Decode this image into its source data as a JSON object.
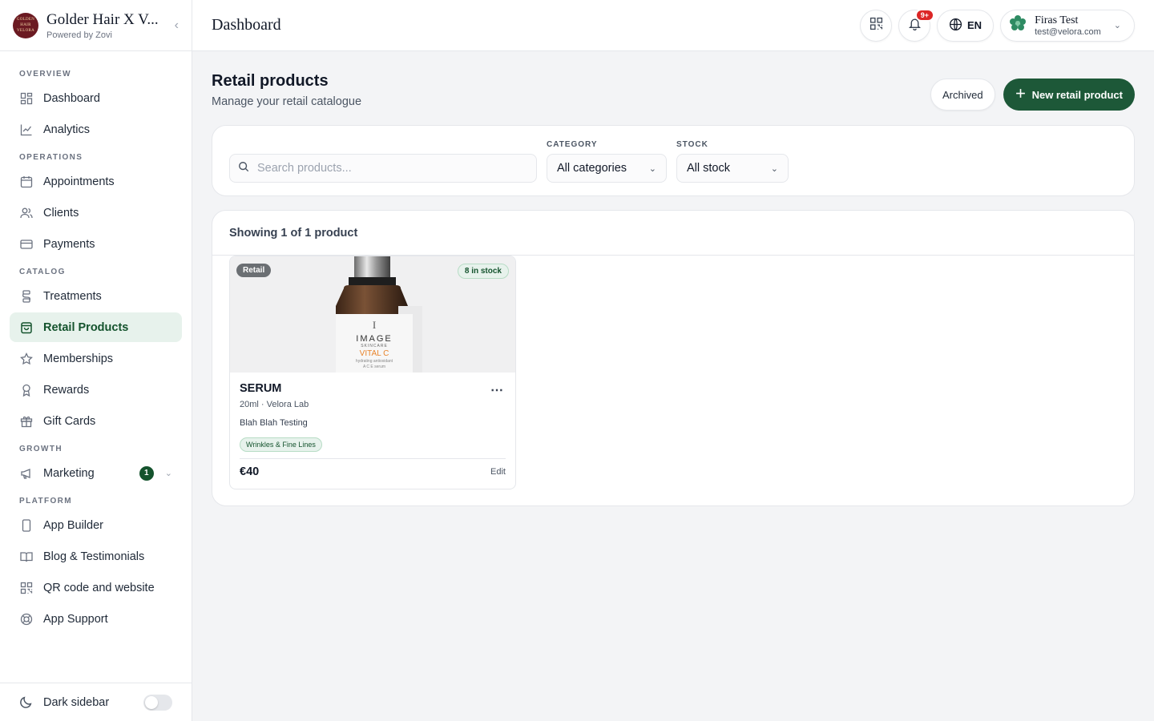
{
  "brand": {
    "name": "Golder Hair X V...",
    "subtitle": "Powered by Zovi",
    "logo_text": "GOLDEN HAIR VELORA"
  },
  "sidebar": {
    "sections": [
      {
        "title": "OVERVIEW",
        "items": [
          {
            "label": "Dashboard",
            "icon": "dashboard-icon"
          },
          {
            "label": "Analytics",
            "icon": "analytics-icon"
          }
        ]
      },
      {
        "title": "OPERATIONS",
        "items": [
          {
            "label": "Appointments",
            "icon": "calendar-icon"
          },
          {
            "label": "Clients",
            "icon": "users-icon"
          },
          {
            "label": "Payments",
            "icon": "credit-card-icon"
          }
        ]
      },
      {
        "title": "CATALOG",
        "items": [
          {
            "label": "Treatments",
            "icon": "treatments-icon"
          },
          {
            "label": "Retail Products",
            "icon": "shopping-bag-icon",
            "active": true
          },
          {
            "label": "Memberships",
            "icon": "star-icon"
          },
          {
            "label": "Rewards",
            "icon": "award-icon"
          },
          {
            "label": "Gift Cards",
            "icon": "gift-icon"
          }
        ]
      },
      {
        "title": "GROWTH",
        "items": [
          {
            "label": "Marketing",
            "icon": "megaphone-icon",
            "badge": "1"
          }
        ]
      },
      {
        "title": "PLATFORM",
        "items": [
          {
            "label": "App Builder",
            "icon": "phone-icon"
          },
          {
            "label": "Blog & Testimonials",
            "icon": "book-icon"
          },
          {
            "label": "QR code and website",
            "icon": "qr-code-icon"
          },
          {
            "label": "App Support",
            "icon": "lifebuoy-icon"
          }
        ]
      }
    ],
    "footer": {
      "label": "Dark sidebar",
      "toggle_on": false
    }
  },
  "topbar": {
    "title": "Dashboard",
    "notifications_badge": "9+",
    "language": "EN",
    "user": {
      "name": "Firas Test",
      "email": "test@velora.com"
    }
  },
  "page": {
    "title": "Retail products",
    "subtitle": "Manage your retail catalogue",
    "archived_label": "Archived",
    "new_label": "New retail product"
  },
  "filters": {
    "search_placeholder": "Search products...",
    "category_label": "CATEGORY",
    "category_value": "All categories",
    "stock_label": "STOCK",
    "stock_value": "All stock"
  },
  "results": {
    "summary": "Showing 1 of 1 product",
    "products": [
      {
        "type_badge": "Retail",
        "stock_badge": "8 in stock",
        "name": "SERUM",
        "meta": "20ml · Velora Lab",
        "description": "Blah Blah Testing",
        "tag": "Wrinkles & Fine Lines",
        "price": "€40",
        "edit_label": "Edit",
        "image_text": {
          "brand": "IMAGE",
          "brand_sub": "SKINCARE",
          "line": "VITAL C",
          "desc1": "hydrating antioxidant",
          "desc2": "A C E serum"
        }
      }
    ]
  },
  "colors": {
    "accent": "#1d5838",
    "active_bg": "#e7f2ec",
    "notification": "#dc2626"
  }
}
